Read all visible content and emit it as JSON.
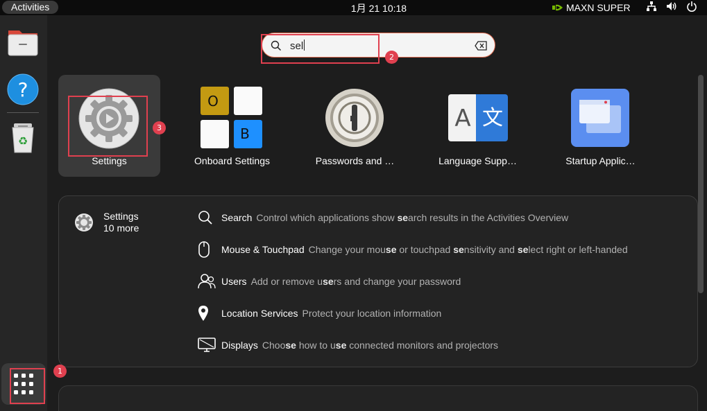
{
  "topbar": {
    "activities_label": "Activities",
    "clock": "1月 21  10:18",
    "power_mode": "MAXN SUPER",
    "icons": [
      "nvidia-logo-icon",
      "network-icon",
      "volume-icon",
      "power-icon"
    ]
  },
  "dock": {
    "items": [
      {
        "name": "files-icon"
      },
      {
        "name": "help-icon"
      },
      {
        "name": "trash-icon"
      }
    ],
    "show_apps_icon": "grid-icon"
  },
  "search": {
    "query": "sel",
    "clear_icon": "backspace-clear-icon",
    "search_icon": "search-icon"
  },
  "apps": [
    {
      "label": "Settings",
      "icon": "settings-gear-icon",
      "selected": true
    },
    {
      "label": "Onboard Settings",
      "icon": "onboard-keyboard-icon",
      "key_o": "O",
      "key_b": "B"
    },
    {
      "label": "Passwords and …",
      "icon": "passwords-keyring-icon"
    },
    {
      "label": "Language Supp…",
      "icon": "language-support-icon",
      "glyph_a": "A",
      "glyph_zh": "文"
    },
    {
      "label": "Startup Applic…",
      "icon": "startup-applications-icon"
    }
  ],
  "results": {
    "provider_name": "Settings",
    "provider_more": "10 more",
    "rows": [
      {
        "title": "Search",
        "icon": "search-icon",
        "desc_parts": [
          "Control which applications show ",
          "se",
          "arch results in the Activities Overview"
        ]
      },
      {
        "title": "Mouse & Touchpad",
        "icon": "mouse-icon",
        "desc_parts": [
          "Change your mou",
          "se",
          " or touchpad ",
          "se",
          "nsitivity and ",
          "se",
          "lect right or left-handed"
        ]
      },
      {
        "title": "Users",
        "icon": "users-icon",
        "desc_parts": [
          "Add or remove u",
          "se",
          "rs and change your password"
        ]
      },
      {
        "title": "Location Services",
        "icon": "location-pin-icon",
        "desc_parts": [
          "Protect your location information"
        ]
      },
      {
        "title": "Displays",
        "icon": "display-icon",
        "desc_parts": [
          "Choo",
          "se",
          " how to u",
          "se",
          " connected monitors and projectors"
        ]
      }
    ]
  },
  "annotations": [
    {
      "label": "1"
    },
    {
      "label": "2"
    },
    {
      "label": "3"
    }
  ],
  "colors": {
    "annotation": "#e0404f",
    "settings_accent": "#2ba9e0",
    "ubuntu_orange": "#e95420"
  }
}
